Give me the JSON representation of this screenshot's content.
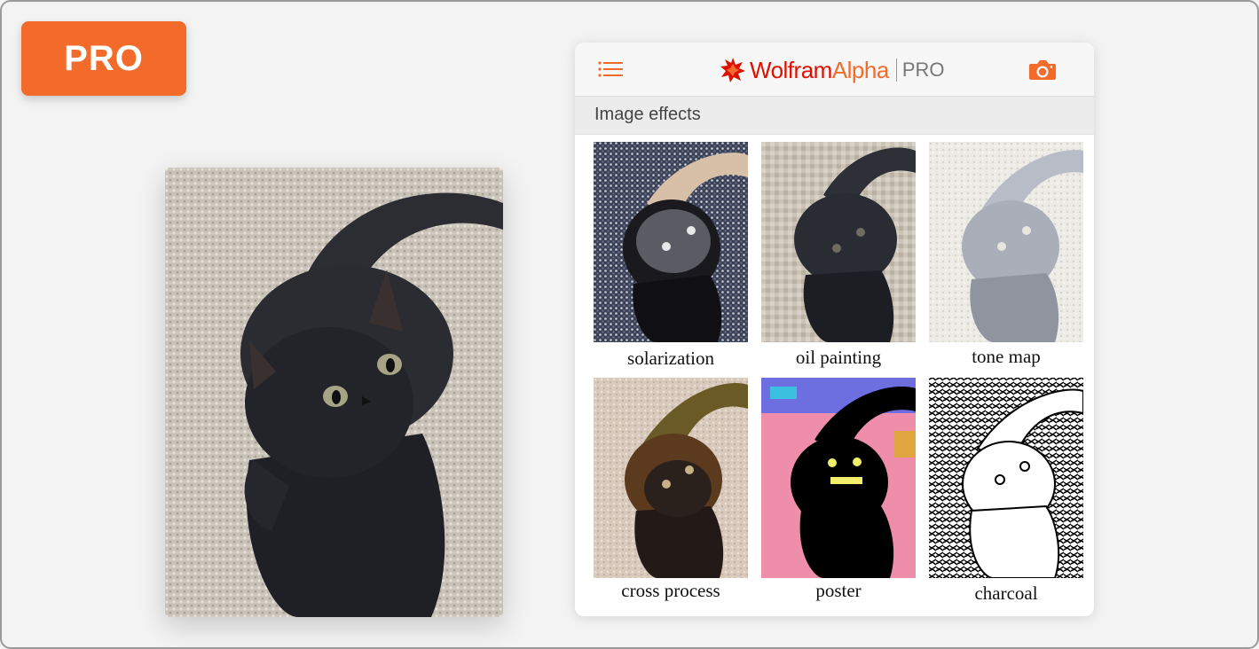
{
  "badge": {
    "label": "PRO"
  },
  "header": {
    "menu_icon": "menu-icon",
    "logo_word_1": "Wolfram",
    "logo_word_2": "Alpha",
    "logo_suffix": "PRO",
    "camera_icon": "camera-icon"
  },
  "section": {
    "title": "Image effects"
  },
  "effects": [
    {
      "label": "solarization"
    },
    {
      "label": "oil painting"
    },
    {
      "label": "tone map"
    },
    {
      "label": "cross process"
    },
    {
      "label": "poster"
    },
    {
      "label": "charcoal"
    }
  ],
  "colors": {
    "accent": "#f26b2a",
    "brand_red": "#dd1100"
  }
}
